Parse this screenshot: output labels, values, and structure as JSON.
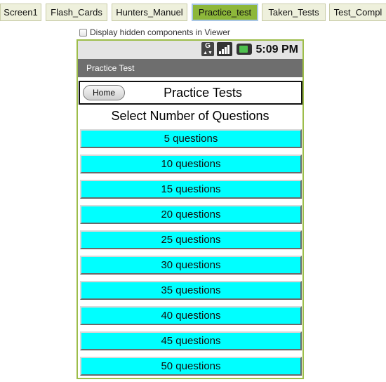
{
  "screen_tabs": [
    {
      "label": "Screen1",
      "active": false
    },
    {
      "label": "Flash_Cards",
      "active": false
    },
    {
      "label": "Hunters_Manuel",
      "active": false
    },
    {
      "label": "Practice_test",
      "active": true
    },
    {
      "label": "Taken_Tests",
      "active": false
    },
    {
      "label": "Test_Compl",
      "active": false
    }
  ],
  "viewer_options": {
    "display_hidden_label": "Display hidden components in Viewer",
    "display_hidden_checked": false
  },
  "status_bar": {
    "network_icon_letter": "G",
    "time": "5:09 PM",
    "battery_color": "#4ec04e"
  },
  "title_bar": "Practice Test",
  "header": {
    "home_label": "Home",
    "title": "Practice Tests"
  },
  "select_label": "Select Number of Questions",
  "question_buttons": [
    "5 questions",
    "10 questions",
    "15 questions",
    "20 questions",
    "25 questions",
    "30 questions",
    "35 questions",
    "40 questions",
    "45 questions",
    "50 questions"
  ],
  "colors": {
    "active_tab": "#8db73a",
    "viewer_border": "#9dbd4a",
    "button_bg": "#00ffff",
    "title_bar_bg": "#6e6e6e"
  }
}
